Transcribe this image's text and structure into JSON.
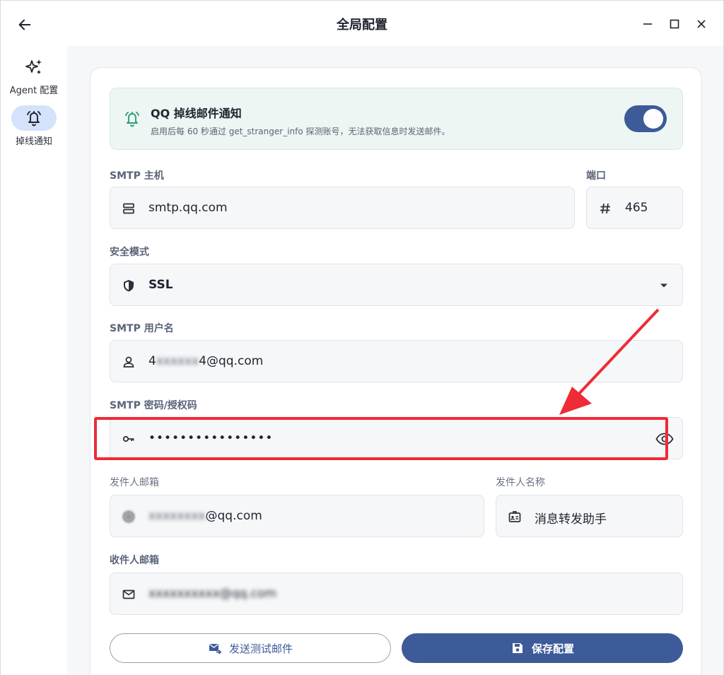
{
  "window": {
    "title": "全局配置"
  },
  "sidebar": {
    "items": [
      {
        "label": "Agent 配置",
        "icon": "sparkles-icon",
        "active": false
      },
      {
        "label": "掉线通知",
        "icon": "bell-ring-icon",
        "active": true
      }
    ]
  },
  "notify": {
    "title": "QQ 掉线邮件通知",
    "description": "启用后每 60 秒通过 get_stranger_info 探测账号，无法获取信息时发送邮件。",
    "enabled": true
  },
  "form": {
    "smtp_host": {
      "label": "SMTP 主机",
      "value": "smtp.qq.com",
      "icon": "server-icon"
    },
    "port": {
      "label": "端口",
      "value": "465",
      "icon": "hash-icon"
    },
    "security": {
      "label": "安全模式",
      "value": "SSL",
      "icon": "shield-icon"
    },
    "username": {
      "label": "SMTP 用户名",
      "value_prefix": "4",
      "value_blurred": "xxxxxx",
      "value_suffix": "4@qq.com",
      "icon": "user-icon"
    },
    "password": {
      "label": "SMTP 密码/授权码",
      "value": "••••••••••••••••",
      "icon": "key-icon"
    },
    "sender_email": {
      "label": "发件人邮箱",
      "value_blurred": "xxxxxxxx",
      "value_suffix": "@qq.com",
      "icon": "at-icon"
    },
    "sender_name": {
      "label": "发件人名称",
      "value": "消息转发助手",
      "icon": "badge-icon"
    },
    "recipient_email": {
      "label": "收件人邮箱",
      "value_blurred": "xxxxxxxxxx@qq.com",
      "icon": "mail-icon"
    }
  },
  "buttons": {
    "test_label": "发送测试邮件",
    "save_label": "保存配置"
  },
  "colors": {
    "accent": "#3d5a99",
    "highlight": "#ee2b36",
    "teal": "#2a9d78"
  }
}
